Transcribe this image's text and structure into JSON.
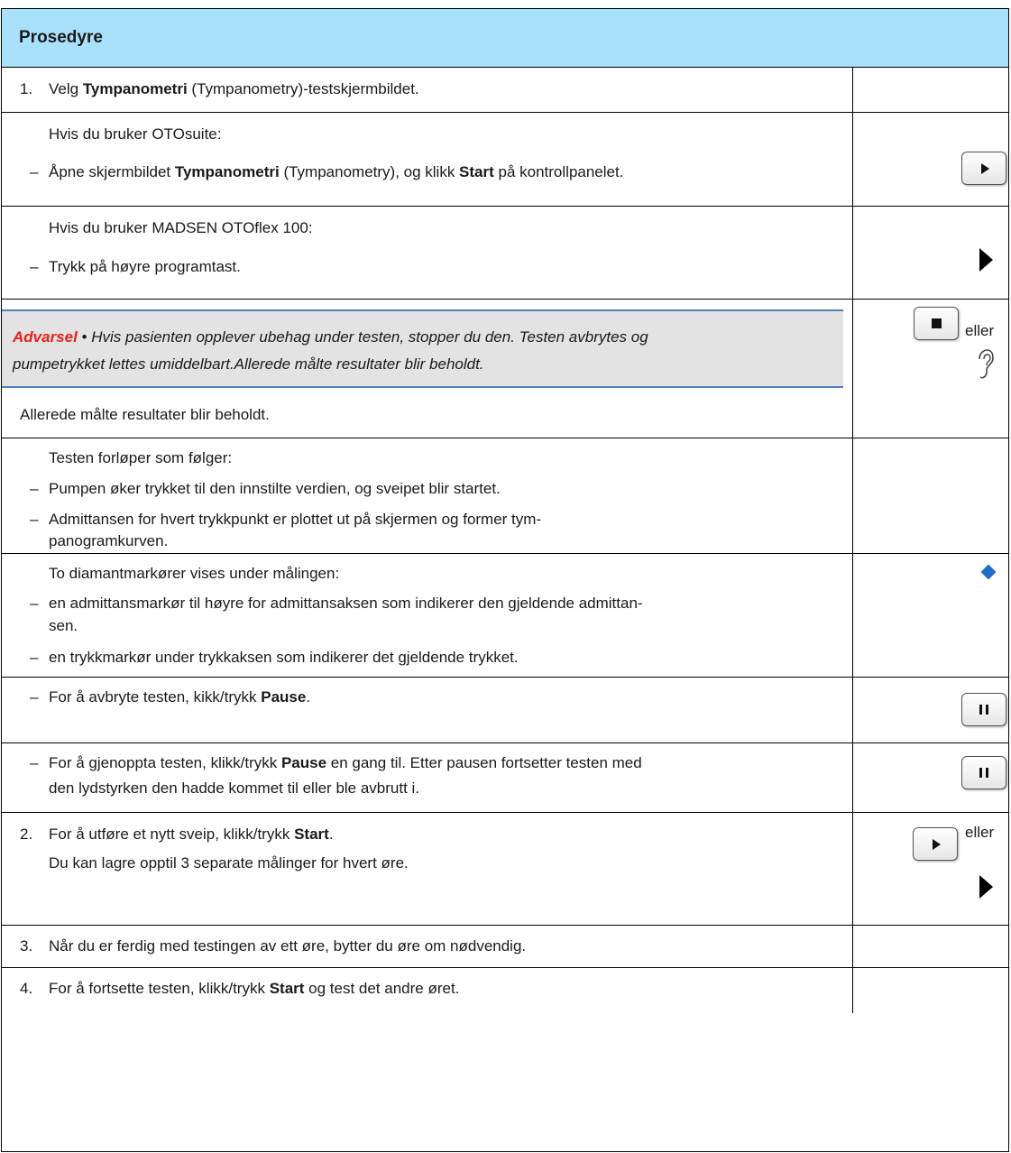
{
  "header": {
    "title": "Prosedyre"
  },
  "step1": {
    "num": "1.",
    "pre": "Velg ",
    "bold": "Tympanometri",
    "post": " (Tympanometry)-testskjermbildet."
  },
  "otosuite": {
    "intro": "Hvis du bruker OTOsuite:",
    "dash": "–",
    "pre": "Åpne skjermbildet ",
    "bold1": "Tympanometri",
    "mid": " (Tympanometry), og klikk ",
    "bold2": "Start",
    "post": " på kontrollpanelet."
  },
  "otoflex": {
    "intro": "Hvis du bruker MADSEN OTOflex 100:",
    "dash": "–",
    "text": "Trykk på høyre programtast."
  },
  "warning": {
    "label": "Advarsel",
    "line1": " • Hvis pasienten opplever ubehag under testen, stopper du den. Testen avbrytes og",
    "line2": "pumpetrykket lettes umiddelbart.Allerede målte resultater blir beholdt.",
    "after": "Allerede målte resultater blir beholdt.",
    "or_text": "eller"
  },
  "process": {
    "intro": "Testen forløper som følger:",
    "dash": "–",
    "item1": "Pumpen øker trykket til den innstilte verdien, og sveipet blir startet.",
    "item2a": "Admittansen for hvert trykkpunkt er plottet ut på skjermen og former tym-",
    "item2b": "panogramkurven."
  },
  "markers": {
    "intro": "To diamantmarkører vises under målingen:",
    "dash": "–",
    "item1a": "en admittansmarkør til høyre for admittansaksen som indikerer den gjeldende admittan-",
    "item1b": "sen.",
    "item2": "en trykkmarkør under trykkaksen som indikerer det gjeldende trykket."
  },
  "pause1": {
    "dash": "–",
    "pre": "For å avbryte testen, kikk/trykk ",
    "bold": "Pause",
    "post": "."
  },
  "pause2": {
    "dash": "–",
    "pre": "For å gjenoppta testen, klikk/trykk ",
    "bold": "Pause",
    "post": " en gang til. Etter pausen fortsetter testen med",
    "line2": "den lydstyrken den hadde kommet til eller ble avbrutt i."
  },
  "step2": {
    "num": "2.",
    "pre": "For å utføre et nytt sveip, klikk/trykk ",
    "bold": "Start",
    "post": ".",
    "line2": "Du kan lagre opptil 3 separate målinger for hvert øre.",
    "or_text": "eller"
  },
  "step3": {
    "num": "3.",
    "text": "Når du er ferdig med testingen av ett øre, bytter du øre om nødvendig."
  },
  "step4": {
    "num": "4.",
    "pre": "For å fortsette testen, klikk/trykk ",
    "bold": "Start",
    "post": " og test det andre øret."
  },
  "icons": {
    "start": "play-icon",
    "stop": "stop-icon",
    "pause": "pause-icon",
    "ear": "ear-icon",
    "diamond": "diamond-marker-icon",
    "diamond_color": "#1f6fc7",
    "header_bg": "#a9e1fb",
    "warning_label_color": "#e8201a"
  }
}
